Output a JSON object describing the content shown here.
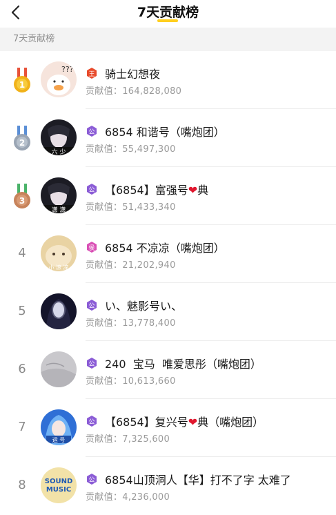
{
  "header": {
    "title": "7天贡献榜"
  },
  "subheader": {
    "label": "7天贡献榜"
  },
  "contrib_label": "贡献值：",
  "rankings": [
    {
      "rank": "1",
      "badge": "王",
      "name": "骑士幻想夜",
      "value": "164,828,080"
    },
    {
      "rank": "2",
      "badge": "公",
      "name": "6854 和谐号（嘴炮团）",
      "value": "55,497,300"
    },
    {
      "rank": "3",
      "badge": "公",
      "name_pre": "【6854】富强号",
      "name_post": "典",
      "value": "51,433,340"
    },
    {
      "rank": "4",
      "badge": "侯",
      "name": "6854 不凉凉（嘴炮团）",
      "value": "21,202,940"
    },
    {
      "rank": "5",
      "badge": "公",
      "name": "い、魅影号い、",
      "value": "13,778,400"
    },
    {
      "rank": "6",
      "badge": "公",
      "name": "240  宝马  唯爱思彤（嘴炮团）",
      "value": "10,613,660"
    },
    {
      "rank": "7",
      "badge": "公",
      "name_pre": "【6854】复兴号",
      "name_post": "典（嘴炮团）",
      "value": "7,325,600"
    },
    {
      "rank": "8",
      "badge": "公",
      "name": "6854山顶洞人【华】打不了字 太难了",
      "value": "4,236,000"
    }
  ],
  "avatar_text": {
    "a1": "???",
    "a2": "六 少",
    "a3": "潇 潇",
    "a4": "小 凉 凉",
    "a7": "运 号",
    "a8_line1": "SOUND",
    "a8_line2": "MUSIC"
  },
  "colors": {
    "accent": "#ffcf1f",
    "gold": "#f1b21a",
    "silver": "#9aa5b4",
    "bronze": "#c7835b",
    "heart": "#e0172e"
  }
}
